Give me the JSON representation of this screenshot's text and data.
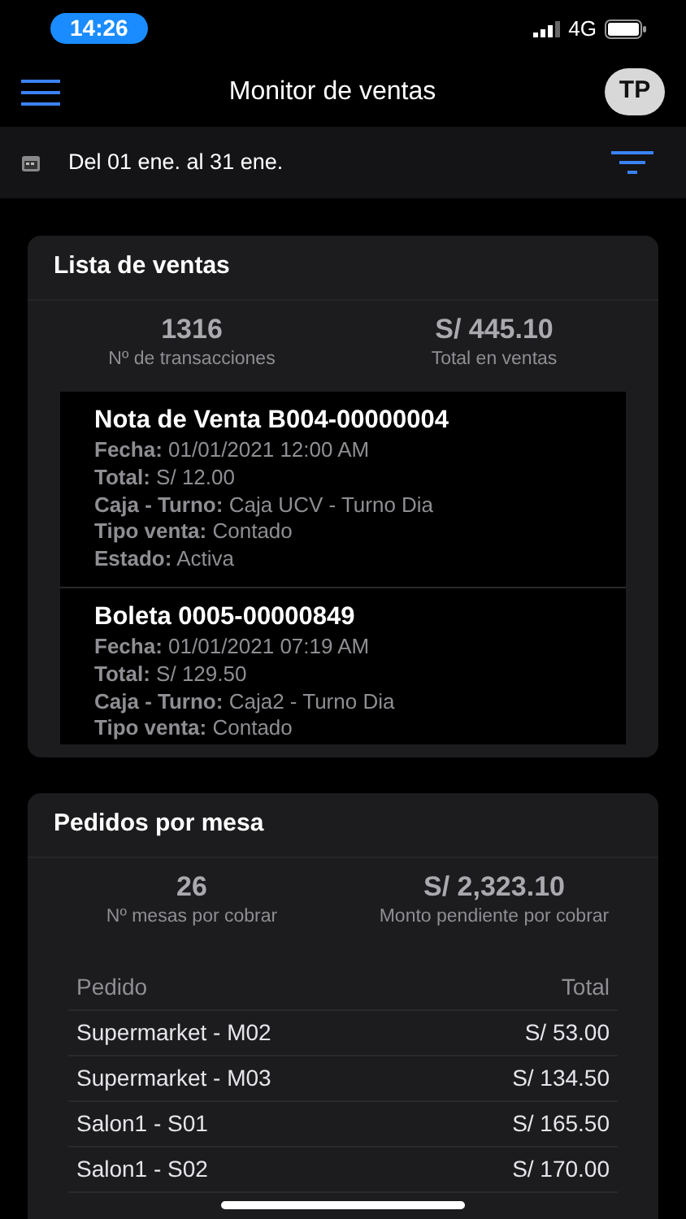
{
  "status_bar": {
    "time": "14:26",
    "network": "4G"
  },
  "header": {
    "title": "Monitor de ventas",
    "avatar": "TP"
  },
  "date_filter": {
    "label": "Del 01 ene. al 31 ene."
  },
  "sales_card": {
    "title": "Lista de ventas",
    "stats": [
      {
        "value": "1316",
        "label": "Nº de transacciones"
      },
      {
        "value": "S/ 445.10",
        "label": "Total en ventas"
      }
    ],
    "sales": [
      {
        "title": "Nota de Venta B004-00000004",
        "fields": [
          {
            "label": "Fecha:",
            "value": "01/01/2021 12:00 AM"
          },
          {
            "label": "Total:",
            "value": "S/ 12.00"
          },
          {
            "label": "Caja - Turno:",
            "value": "Caja UCV - Turno Dia"
          },
          {
            "label": "Tipo venta:",
            "value": "Contado"
          },
          {
            "label": "Estado:",
            "value": "Activa"
          }
        ]
      },
      {
        "title": "Boleta 0005-00000849",
        "fields": [
          {
            "label": "Fecha:",
            "value": "01/01/2021 07:19 AM"
          },
          {
            "label": "Total:",
            "value": "S/ 129.50"
          },
          {
            "label": "Caja - Turno:",
            "value": "Caja2 - Turno Dia"
          },
          {
            "label": "Tipo venta:",
            "value": "Contado"
          }
        ]
      }
    ]
  },
  "orders_card": {
    "title": "Pedidos por mesa",
    "stats": [
      {
        "value": "26",
        "label": "Nº mesas por cobrar"
      },
      {
        "value": "S/ 2,323.10",
        "label": "Monto pendiente por cobrar"
      }
    ],
    "table": {
      "columns": [
        "Pedido",
        "Total"
      ],
      "rows": [
        [
          "Supermarket - M02",
          "S/ 53.00"
        ],
        [
          "Supermarket - M03",
          "S/ 134.50"
        ],
        [
          "Salon1 - S01",
          "S/ 165.50"
        ],
        [
          "Salon1 - S02",
          "S/ 170.00"
        ]
      ]
    }
  }
}
